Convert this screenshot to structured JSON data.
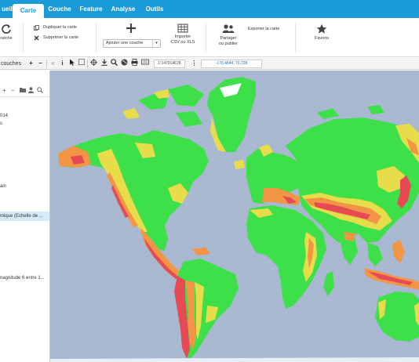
{
  "tabs": [
    {
      "label": "ueil",
      "active": false
    },
    {
      "label": "Carte",
      "active": true
    },
    {
      "label": "Couche",
      "active": false
    },
    {
      "label": "Feature",
      "active": false
    },
    {
      "label": "Analyse",
      "active": false
    },
    {
      "label": "Outils",
      "active": false
    }
  ],
  "ribbon": {
    "refresh_label": "ratche",
    "duplicate_label": "Dupliquer la carte",
    "delete_label": "Supprimer la carte",
    "add_layer_select": "Ajouter une couche",
    "import_label_1": "Importer",
    "import_label_2": "CSV ou XLS",
    "share_label_1": "Partager",
    "share_label_2": "ou publier",
    "export_label": "Exporter la carte",
    "favorites_label": "Favoris"
  },
  "toolbar": {
    "panel_title": "couches",
    "scale": "1:147914678",
    "coordinates": "-176.4644, 70.728"
  },
  "panel_items": [
    {
      "text": "014",
      "selected": false
    },
    {
      "text": "s",
      "selected": false
    },
    {
      "text": "ain",
      "selected": false
    },
    {
      "text": "mique (Echelle de ...",
      "selected": true
    },
    {
      "text": "nagnitude 6 entre 1...",
      "selected": false
    }
  ],
  "colors": {
    "accent": "#1a9bd7",
    "ocean": "#aab9d2",
    "low_hazard": "#3ee04a",
    "moderate_hazard": "#e7dc4a",
    "high_hazard": "#f29545",
    "very_high_hazard": "#e64a55",
    "selected_row": "#d5ebf8"
  }
}
